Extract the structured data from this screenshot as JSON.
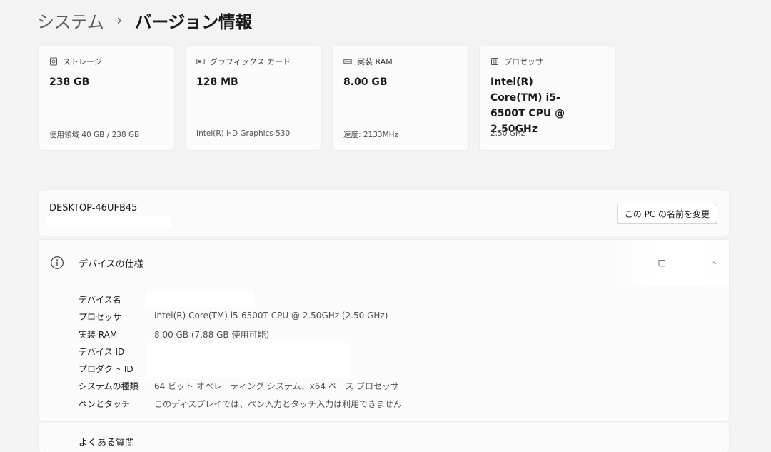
{
  "breadcrumb": {
    "parent": "システム",
    "separator": "›",
    "current": "バージョン情報"
  },
  "spec_cards": [
    {
      "icon": "storage-icon",
      "label": "ストレージ",
      "value": "238 GB",
      "sub": "使用領域 40 GB / 238 GB"
    },
    {
      "icon": "graphics-card-icon",
      "label": "グラフィックス カード",
      "value": "128 MB",
      "sub": "Intel(R) HD Graphics 530"
    },
    {
      "icon": "ram-icon",
      "label": "実装 RAM",
      "value": "8.00 GB",
      "sub": "速度: 2133MHz"
    },
    {
      "icon": "processor-icon",
      "label": "プロセッサ",
      "value": "Intel(R) Core(TM) i5-6500T CPU @ 2.50GHz",
      "sub": "2.50 GHz"
    }
  ],
  "device": {
    "hostname": "DESKTOP-46UFB45",
    "rename_button": "この PC の名前を変更"
  },
  "specs": {
    "title": "デバイスの仕様",
    "copy_fragment": "ㄈ",
    "rows": [
      {
        "label": "デバイス名",
        "value": ""
      },
      {
        "label": "プロセッサ",
        "value": "Intel(R) Core(TM) i5-6500T CPU @ 2.50GHz (2.50 GHz)"
      },
      {
        "label": "実装 RAM",
        "value": "8.00 GB (7.88 GB 使用可能)"
      },
      {
        "label": "デバイス ID",
        "value": ""
      },
      {
        "label": "プロダクト ID",
        "value": ""
      },
      {
        "label": "システムの種類",
        "value": "64 ビット オペレーティング システム、x64 ベース プロセッサ"
      },
      {
        "label": "ペンとタッチ",
        "value": "このディスプレイでは、ペン入力とタッチ入力は利用できません"
      }
    ]
  },
  "faq": {
    "title": "よくある質問"
  },
  "colors": {
    "background": "#f3f3f3",
    "card": "#fbfbfb",
    "text": "#1a1a1a",
    "secondary_text": "#505050"
  }
}
